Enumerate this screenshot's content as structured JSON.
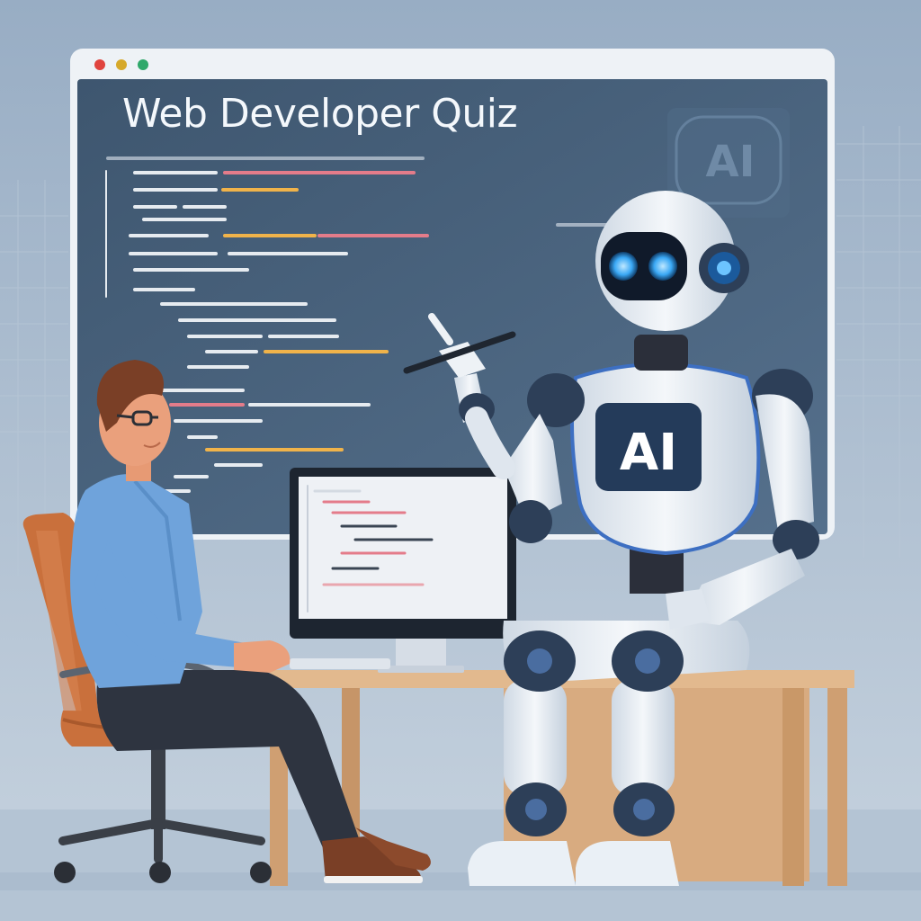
{
  "window": {
    "title": "Web Developer Quiz",
    "controls": [
      "close-dot",
      "minimize-dot",
      "maximize-dot"
    ]
  },
  "board": {
    "badge_text": "AI"
  },
  "robot": {
    "chest_label": "AI"
  },
  "colors": {
    "background": "#a9bcd0",
    "window_frame": "#eef2f6",
    "board": "#47617c",
    "dot_close": "#e0443e",
    "dot_minimize": "#d6a92b",
    "dot_maximize": "#2fa86a",
    "robot_body": "#e8eef5",
    "robot_joint": "#2d3f58",
    "robot_eye": "#49b6ff",
    "man_shirt": "#6fa3db",
    "man_pants": "#2e3440",
    "chair": "#c9703c",
    "desk": "#d8ab80"
  }
}
